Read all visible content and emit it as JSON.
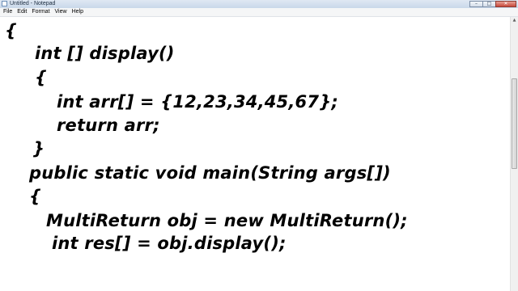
{
  "window": {
    "title": "Untitled - Notepad",
    "controls": {
      "minimize": "–",
      "maximize": "□",
      "close": "✕"
    }
  },
  "menubar": {
    "items": [
      {
        "label": "File"
      },
      {
        "label": "Edit"
      },
      {
        "label": "Format"
      },
      {
        "label": "View"
      },
      {
        "label": "Help"
      }
    ]
  },
  "editor": {
    "lines": [
      "{",
      "int [] display()",
      "{",
      "int arr[] = {12,23,34,45,67};",
      "return arr;",
      "}",
      "public static void main(String args[])",
      "{",
      "MultiReturn obj = new MultiReturn();",
      "int res[] = obj.display();"
    ]
  },
  "scrollbar": {
    "up_arrow": "▲"
  },
  "colors": {
    "titlebar": "#c9d8ea",
    "close_button": "#c7483a",
    "text": "#000000"
  }
}
